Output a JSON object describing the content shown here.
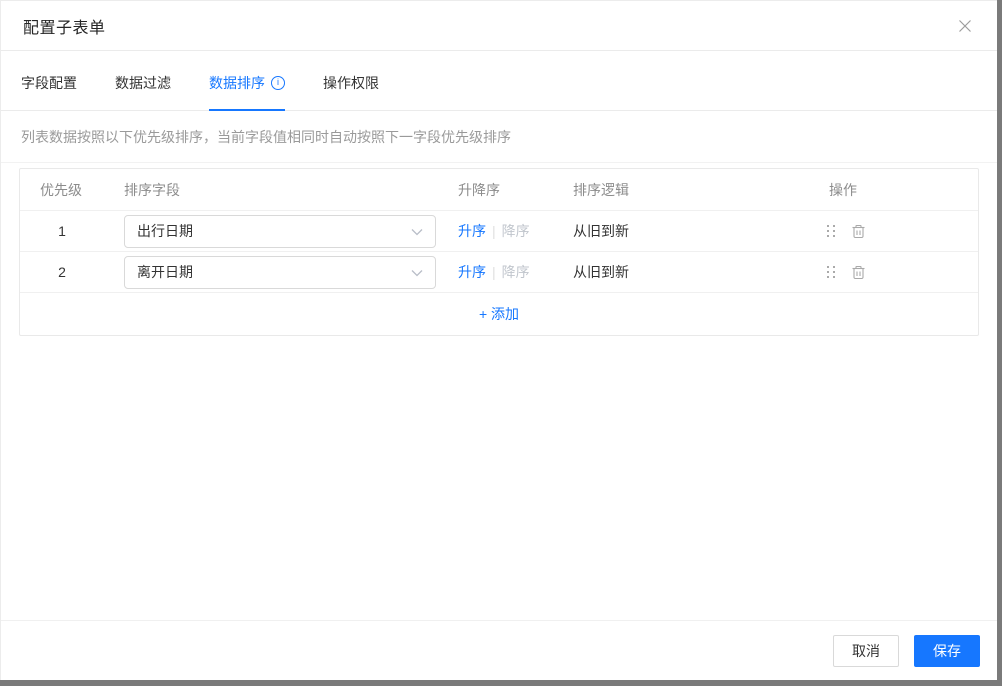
{
  "dialog": {
    "title": "配置子表单"
  },
  "icons": {
    "close": "close-icon",
    "info": "info-circle-icon",
    "info_glyph": "i",
    "chevron_down": "chevron-down-icon",
    "drag_handle": "drag-handle-icon",
    "trash": "trash-icon"
  },
  "tabs": [
    {
      "label": "字段配置",
      "active": false
    },
    {
      "label": "数据过滤",
      "active": false
    },
    {
      "label": "数据排序",
      "active": true,
      "has_info_icon": true
    },
    {
      "label": "操作权限",
      "active": false
    }
  ],
  "description": "列表数据按照以下优先级排序，当前字段值相同时自动按照下一字段优先级排序",
  "table": {
    "headers": {
      "priority": "优先级",
      "field": "排序字段",
      "order": "升降序",
      "logic": "排序逻辑",
      "actions": "操作"
    },
    "rows": [
      {
        "priority": "1",
        "field": "出行日期",
        "asc": "升序",
        "divider": "|",
        "desc": "降序",
        "logic": "从旧到新"
      },
      {
        "priority": "2",
        "field": "离开日期",
        "asc": "升序",
        "divider": "|",
        "desc": "降序",
        "logic": "从旧到新"
      }
    ],
    "add_label": "+ 添加"
  },
  "footer": {
    "cancel": "取消",
    "save": "保存"
  },
  "colors": {
    "accent": "#1677ff",
    "muted_text": "#8c8c8c",
    "disabled_text": "#c1c6cd",
    "border": "#e9e9e9",
    "window_edge": "#7a7a7a"
  }
}
